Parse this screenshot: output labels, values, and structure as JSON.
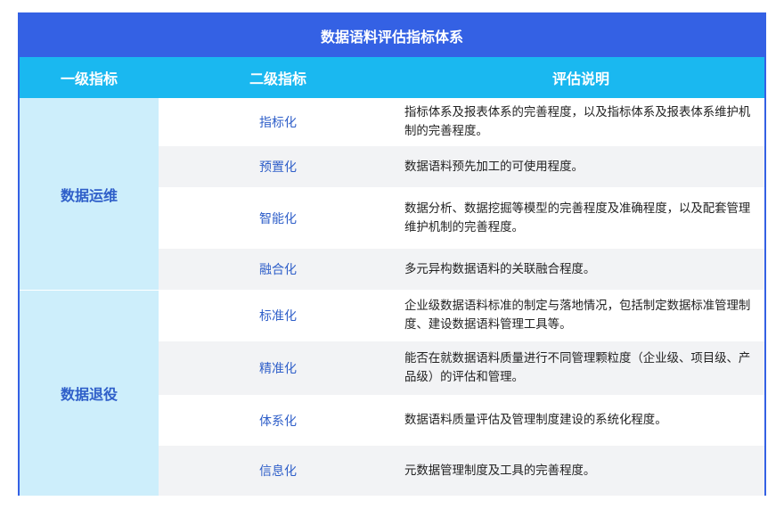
{
  "table": {
    "title": "数据语料评估指标体系",
    "headers": {
      "level1": "一级指标",
      "level2": "二级指标",
      "description": "评估说明"
    },
    "groups": [
      {
        "name": "数据运维"
      },
      {
        "name": "数据退役"
      }
    ],
    "rows": [
      {
        "level2": "指标化",
        "description": "指标体系及报表体系的完善程度，以及指标体系及报表体系维护机制的完善程度。"
      },
      {
        "level2": "预置化",
        "description": "数据语料预先加工的可使用程度。"
      },
      {
        "level2": "智能化",
        "description": "数据分析、数据挖掘等模型的完善程度及准确程度，以及配套管理维护机制的完善程度。"
      },
      {
        "level2": "融合化",
        "description": "多元异构数据语料的关联融合程度。"
      },
      {
        "level2": "标准化",
        "description": "企业级数据语料标准的制定与落地情况，包括制定数据标准管理制度、建设数据语料管理工具等。"
      },
      {
        "level2": "精准化",
        "description": "能否在就数据语料质量进行不同管理颗粒度（企业级、项目级、产品级）的评估和管理。"
      },
      {
        "level2": "体系化",
        "description": "数据语料质量评估及管理制度建设的系统化程度。"
      },
      {
        "level2": "信息化",
        "description": "元数据管理制度及工具的完善程度。"
      }
    ]
  }
}
